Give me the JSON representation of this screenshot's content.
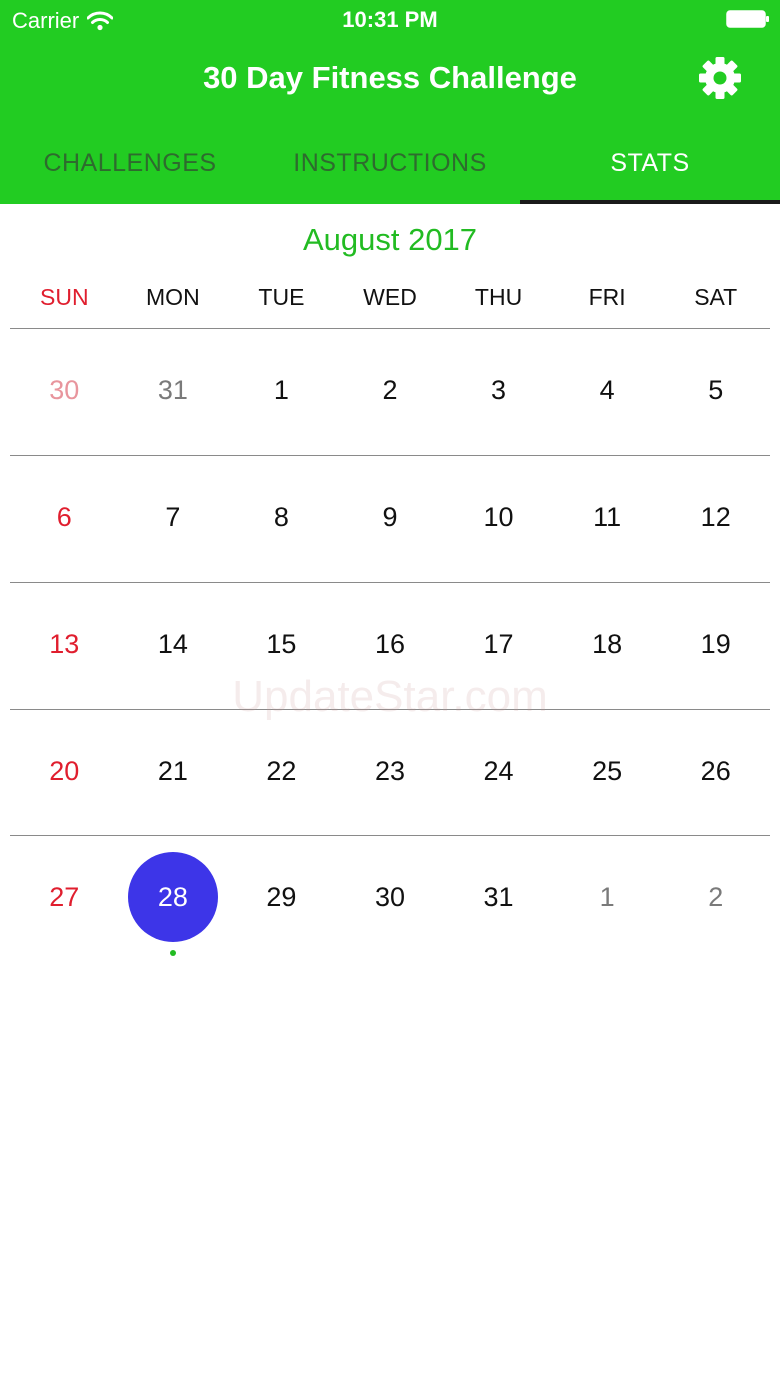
{
  "status_bar": {
    "carrier": "Carrier",
    "time": "10:31 PM"
  },
  "header": {
    "title": "30 Day Fitness Challenge",
    "settings_icon": "gear-icon",
    "background_color": "#22cc22"
  },
  "tabs": [
    {
      "label": "CHALLENGES",
      "active": false
    },
    {
      "label": "INSTRUCTIONS",
      "active": false
    },
    {
      "label": "STATS",
      "active": true
    }
  ],
  "calendar": {
    "month_label": "August 2017",
    "weekdays": [
      "SUN",
      "MON",
      "TUE",
      "WED",
      "THU",
      "FRI",
      "SAT"
    ],
    "weeks": [
      [
        "30",
        "31",
        "1",
        "2",
        "3",
        "4",
        "5"
      ],
      [
        "6",
        "7",
        "8",
        "9",
        "10",
        "11",
        "12"
      ],
      [
        "13",
        "14",
        "15",
        "16",
        "17",
        "18",
        "19"
      ],
      [
        "20",
        "21",
        "22",
        "23",
        "24",
        "25",
        "26"
      ],
      [
        "27",
        "28",
        "29",
        "30",
        "31",
        "1",
        "2"
      ]
    ],
    "selected_date": "28",
    "selected_color": "#3d35e8",
    "sunday_color": "#e01e2e",
    "accent_color": "#22bb22"
  },
  "watermark": "UpdateStar.com"
}
